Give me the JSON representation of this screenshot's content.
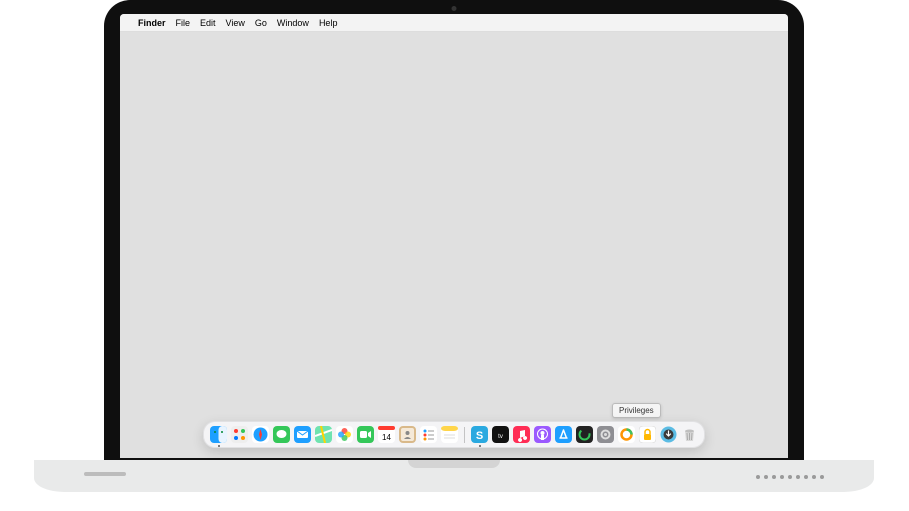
{
  "menubar": {
    "app": "Finder",
    "items": [
      "File",
      "Edit",
      "View",
      "Go",
      "Window",
      "Help"
    ]
  },
  "tooltip": "Privileges",
  "dock": {
    "items": [
      {
        "name": "finder-icon",
        "label": "Finder",
        "running": true
      },
      {
        "name": "launchpad-icon",
        "label": "Launchpad",
        "running": false
      },
      {
        "name": "safari-icon",
        "label": "Safari",
        "running": false
      },
      {
        "name": "messages-icon",
        "label": "Messages",
        "running": false
      },
      {
        "name": "mail-icon",
        "label": "Mail",
        "running": false
      },
      {
        "name": "maps-icon",
        "label": "Maps",
        "running": false
      },
      {
        "name": "photos-icon",
        "label": "Photos",
        "running": false
      },
      {
        "name": "facetime-icon",
        "label": "FaceTime",
        "running": false
      },
      {
        "name": "calendar-icon",
        "label": "Calendar",
        "running": false,
        "badge": "14"
      },
      {
        "name": "contacts-icon",
        "label": "Contacts",
        "running": false
      },
      {
        "name": "reminders-icon",
        "label": "Reminders",
        "running": false
      },
      {
        "name": "notes-icon",
        "label": "Notes",
        "running": false
      }
    ],
    "items2": [
      {
        "name": "snagit-icon",
        "label": "Snagit",
        "running": true
      },
      {
        "name": "tv-icon",
        "label": "TV",
        "running": false
      },
      {
        "name": "music-icon",
        "label": "Music",
        "running": false
      },
      {
        "name": "podcasts-icon",
        "label": "Podcasts",
        "running": false
      },
      {
        "name": "appstore-icon",
        "label": "App Store",
        "running": false
      },
      {
        "name": "activity-icon",
        "label": "Activity Monitor",
        "running": false
      },
      {
        "name": "system-preferences-icon",
        "label": "System Preferences",
        "running": false
      },
      {
        "name": "self-service-icon",
        "label": "Self Service",
        "running": false
      },
      {
        "name": "privileges-icon",
        "label": "Privileges",
        "running": false
      },
      {
        "name": "downloads-icon",
        "label": "Downloads",
        "running": false
      },
      {
        "name": "trash-icon",
        "label": "Trash",
        "running": false
      }
    ]
  }
}
